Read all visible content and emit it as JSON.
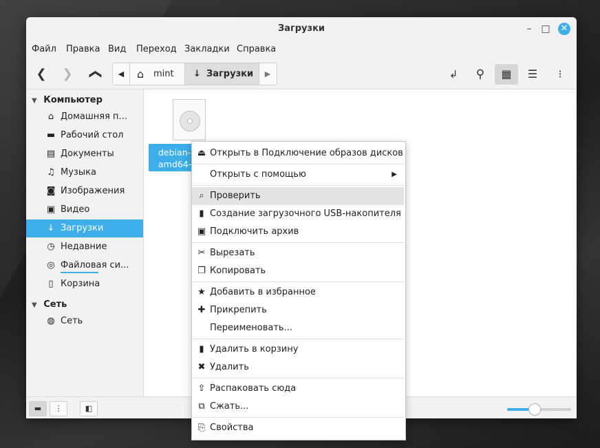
{
  "window": {
    "title": "Загрузки",
    "minimize": "–",
    "maximize": "□",
    "close": "✕"
  },
  "menubar": [
    "Файл",
    "Правка",
    "Вид",
    "Переход",
    "Закладки",
    "Справка"
  ],
  "toolbar": {
    "back": "❮",
    "forward": "❯",
    "up": "❯",
    "path_left": "◀",
    "path_home_icon": "⌂",
    "path_home": "mint",
    "path_current_icon": "↓",
    "path_current": "Загрузки",
    "path_right": "▶",
    "terminal": "↲",
    "search": "⚲",
    "view_icons": "▦",
    "view_list": "☰",
    "view_compact": "⁝"
  },
  "sidebar": {
    "section_computer": "Компьютер",
    "section_network": "Сеть",
    "items": [
      {
        "icon": "⌂",
        "label": "Домашняя п..."
      },
      {
        "icon": "▬",
        "label": "Рабочий стол"
      },
      {
        "icon": "▤",
        "label": "Документы"
      },
      {
        "icon": "♫",
        "label": "Музыка"
      },
      {
        "icon": "◙",
        "label": "Изображения"
      },
      {
        "icon": "▣",
        "label": "Видео"
      },
      {
        "icon": "↓",
        "label": "Загрузки"
      },
      {
        "icon": "◷",
        "label": "Недавние"
      },
      {
        "icon": "◎",
        "label": "Файловая си..."
      },
      {
        "icon": "▯",
        "label": "Корзина"
      }
    ],
    "network_items": [
      {
        "icon": "◍",
        "label": "Сеть"
      }
    ]
  },
  "file": {
    "line1": "debian-",
    "line2": "amd64-ne"
  },
  "context_menu": [
    {
      "icon": "⏏",
      "label": "Открыть в Подключение образов дисков"
    },
    {
      "icon": "",
      "label": "Открыть с помощью",
      "arrow": "▶"
    },
    {
      "icon": "⌕",
      "label": "Проверить"
    },
    {
      "icon": "▮",
      "label": "Создание загрузочного USB-накопителя"
    },
    {
      "icon": "▣",
      "label": "Подключить архив"
    },
    {
      "icon": "✂",
      "label": "Вырезать"
    },
    {
      "icon": "❐",
      "label": "Копировать"
    },
    {
      "icon": "★",
      "label": "Добавить в избранное"
    },
    {
      "icon": "✚",
      "label": "Прикрепить"
    },
    {
      "icon": "",
      "label": "Переименовать..."
    },
    {
      "icon": "▮",
      "label": "Удалить в корзину"
    },
    {
      "icon": "✖",
      "label": "Удалить"
    },
    {
      "icon": "⇪",
      "label": "Распаковать сюда"
    },
    {
      "icon": "⧉",
      "label": "Сжать..."
    },
    {
      "icon": "⎘",
      "label": "Свойства"
    }
  ],
  "statusbar": {
    "places": "▬",
    "tree": "⋮",
    "hide": "◧"
  },
  "zoom_level": 0.42
}
